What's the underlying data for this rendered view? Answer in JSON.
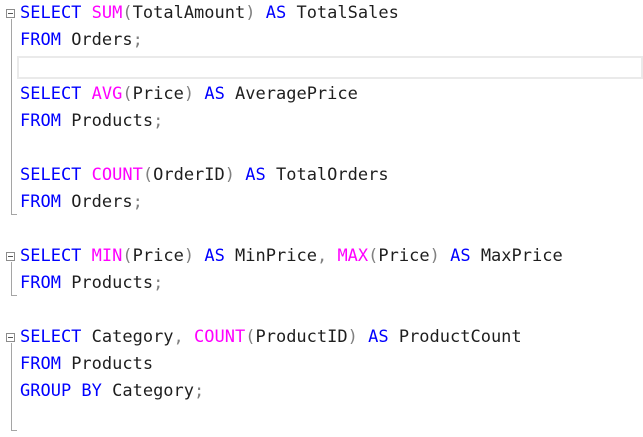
{
  "colors": {
    "keyword": "#0000ff",
    "function": "#ff00ff",
    "operator": "#808080",
    "identifier": "#1e1e1e",
    "background": "#ffffff"
  },
  "editor": {
    "lines": [
      {
        "tokens": [
          {
            "type": "kw",
            "text": "SELECT"
          },
          {
            "type": "id",
            "text": " "
          },
          {
            "type": "fn",
            "text": "SUM"
          },
          {
            "type": "op",
            "text": "("
          },
          {
            "type": "id",
            "text": "TotalAmount"
          },
          {
            "type": "op",
            "text": ")"
          },
          {
            "type": "id",
            "text": " "
          },
          {
            "type": "kw",
            "text": "AS"
          },
          {
            "type": "id",
            "text": " TotalSales"
          }
        ]
      },
      {
        "tokens": [
          {
            "type": "kw",
            "text": "FROM"
          },
          {
            "type": "id",
            "text": " Orders"
          },
          {
            "type": "op",
            "text": ";"
          }
        ]
      },
      {
        "tokens": []
      },
      {
        "tokens": [
          {
            "type": "kw",
            "text": "SELECT"
          },
          {
            "type": "id",
            "text": " "
          },
          {
            "type": "fn",
            "text": "AVG"
          },
          {
            "type": "op",
            "text": "("
          },
          {
            "type": "id",
            "text": "Price"
          },
          {
            "type": "op",
            "text": ")"
          },
          {
            "type": "id",
            "text": " "
          },
          {
            "type": "kw",
            "text": "AS"
          },
          {
            "type": "id",
            "text": " AveragePrice"
          }
        ]
      },
      {
        "tokens": [
          {
            "type": "kw",
            "text": "FROM"
          },
          {
            "type": "id",
            "text": " Products"
          },
          {
            "type": "op",
            "text": ";"
          }
        ]
      },
      {
        "tokens": []
      },
      {
        "tokens": [
          {
            "type": "kw",
            "text": "SELECT"
          },
          {
            "type": "id",
            "text": " "
          },
          {
            "type": "fn",
            "text": "COUNT"
          },
          {
            "type": "op",
            "text": "("
          },
          {
            "type": "id",
            "text": "OrderID"
          },
          {
            "type": "op",
            "text": ")"
          },
          {
            "type": "id",
            "text": " "
          },
          {
            "type": "kw",
            "text": "AS"
          },
          {
            "type": "id",
            "text": " TotalOrders"
          }
        ]
      },
      {
        "tokens": [
          {
            "type": "kw",
            "text": "FROM"
          },
          {
            "type": "id",
            "text": " Orders"
          },
          {
            "type": "op",
            "text": ";"
          }
        ]
      },
      {
        "tokens": []
      },
      {
        "tokens": [
          {
            "type": "kw",
            "text": "SELECT"
          },
          {
            "type": "id",
            "text": " "
          },
          {
            "type": "fn",
            "text": "MIN"
          },
          {
            "type": "op",
            "text": "("
          },
          {
            "type": "id",
            "text": "Price"
          },
          {
            "type": "op",
            "text": ")"
          },
          {
            "type": "id",
            "text": " "
          },
          {
            "type": "kw",
            "text": "AS"
          },
          {
            "type": "id",
            "text": " MinPrice"
          },
          {
            "type": "op",
            "text": ","
          },
          {
            "type": "id",
            "text": " "
          },
          {
            "type": "fn",
            "text": "MAX"
          },
          {
            "type": "op",
            "text": "("
          },
          {
            "type": "id",
            "text": "Price"
          },
          {
            "type": "op",
            "text": ")"
          },
          {
            "type": "id",
            "text": " "
          },
          {
            "type": "kw",
            "text": "AS"
          },
          {
            "type": "id",
            "text": " MaxPrice"
          }
        ]
      },
      {
        "tokens": [
          {
            "type": "kw",
            "text": "FROM"
          },
          {
            "type": "id",
            "text": " Products"
          },
          {
            "type": "op",
            "text": ";"
          }
        ]
      },
      {
        "tokens": []
      },
      {
        "tokens": [
          {
            "type": "kw",
            "text": "SELECT"
          },
          {
            "type": "id",
            "text": " Category"
          },
          {
            "type": "op",
            "text": ","
          },
          {
            "type": "id",
            "text": " "
          },
          {
            "type": "fn",
            "text": "COUNT"
          },
          {
            "type": "op",
            "text": "("
          },
          {
            "type": "id",
            "text": "ProductID"
          },
          {
            "type": "op",
            "text": ")"
          },
          {
            "type": "id",
            "text": " "
          },
          {
            "type": "kw",
            "text": "AS"
          },
          {
            "type": "id",
            "text": " ProductCount"
          }
        ]
      },
      {
        "tokens": [
          {
            "type": "kw",
            "text": "FROM"
          },
          {
            "type": "id",
            "text": " Products"
          }
        ]
      },
      {
        "tokens": [
          {
            "type": "kw",
            "text": "GROUP BY"
          },
          {
            "type": "id",
            "text": " Category"
          },
          {
            "type": "op",
            "text": ";"
          }
        ]
      }
    ]
  }
}
